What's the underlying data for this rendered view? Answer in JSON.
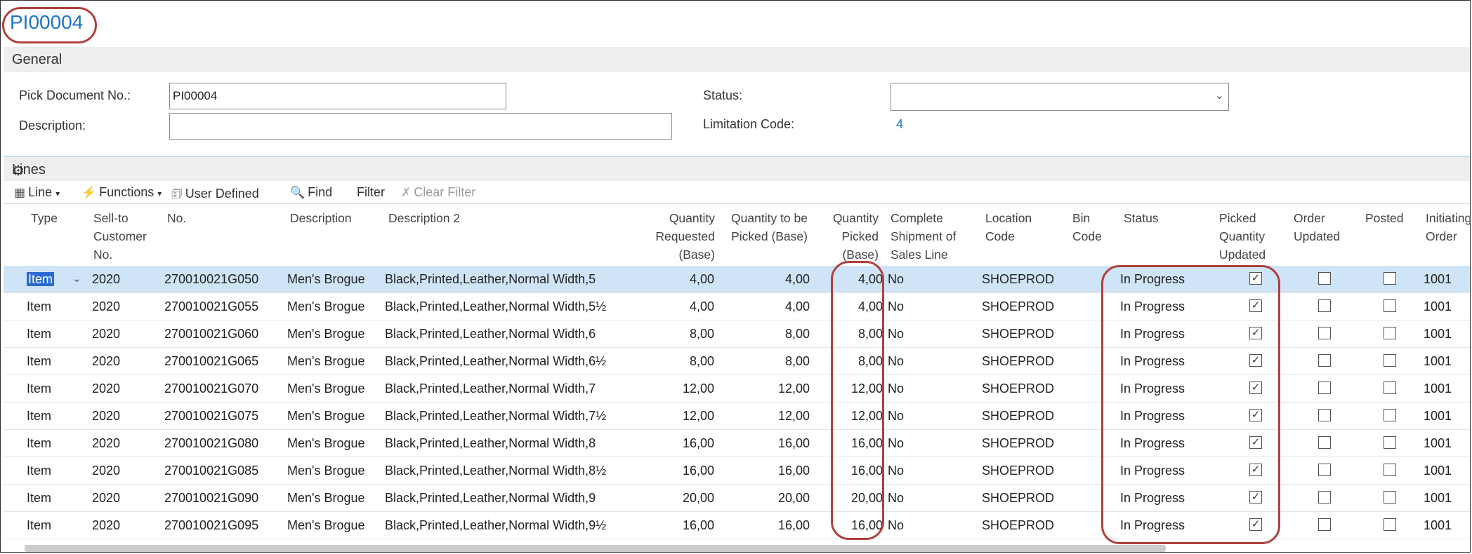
{
  "page": {
    "title": "PI00004"
  },
  "general": {
    "section_title": "General",
    "pick_document_label": "Pick Document No.:",
    "pick_document_value": "PI00004",
    "description_label": "Description:",
    "description_value": "",
    "status_label": "Status:",
    "status_value": "",
    "limitation_label": "Limitation Code:",
    "limitation_value": "4"
  },
  "lines": {
    "section_title": "Lines",
    "toolbar": {
      "line": "Line",
      "functions": "Functions",
      "user_defined": "User Defined",
      "find": "Find",
      "filter": "Filter",
      "clear_filter": "Clear Filter"
    },
    "headers": {
      "type": "Type",
      "sell_to": "Sell-to Customer No.",
      "no": "No.",
      "description": "Description",
      "description2": "Description 2",
      "qty_requested": "Quantity Requested (Base)",
      "qty_to_pick": "Quantity to be Picked (Base)",
      "qty_picked": "Quantity Picked (Base)",
      "complete_shipment": "Complete Shipment of Sales Line",
      "location": "Location Code",
      "bin": "Bin Code",
      "status": "Status",
      "picked_qty_updated": "Picked Quantity Updated",
      "order_updated": "Order Updated",
      "posted": "Posted",
      "initiating_order": "Initiating Order No."
    },
    "rows": [
      {
        "type": "Item",
        "sell_to": "2020",
        "no": "270010021G050",
        "description": "Men's Brogue",
        "description2": "Black,Printed,Leather,Normal Width,5",
        "qty_requested": "4,00",
        "qty_to_pick": "4,00",
        "qty_picked": "4,00",
        "complete_shipment": "No",
        "location": "SHOEPROD",
        "bin": "",
        "status": "In Progress",
        "picked_qty_updated": true,
        "order_updated": false,
        "posted": false,
        "initiating_order": "1001"
      },
      {
        "type": "Item",
        "sell_to": "2020",
        "no": "270010021G055",
        "description": "Men's Brogue",
        "description2": "Black,Printed,Leather,Normal Width,5½",
        "qty_requested": "4,00",
        "qty_to_pick": "4,00",
        "qty_picked": "4,00",
        "complete_shipment": "No",
        "location": "SHOEPROD",
        "bin": "",
        "status": "In Progress",
        "picked_qty_updated": true,
        "order_updated": false,
        "posted": false,
        "initiating_order": "1001"
      },
      {
        "type": "Item",
        "sell_to": "2020",
        "no": "270010021G060",
        "description": "Men's Brogue",
        "description2": "Black,Printed,Leather,Normal Width,6",
        "qty_requested": "8,00",
        "qty_to_pick": "8,00",
        "qty_picked": "8,00",
        "complete_shipment": "No",
        "location": "SHOEPROD",
        "bin": "",
        "status": "In Progress",
        "picked_qty_updated": true,
        "order_updated": false,
        "posted": false,
        "initiating_order": "1001"
      },
      {
        "type": "Item",
        "sell_to": "2020",
        "no": "270010021G065",
        "description": "Men's Brogue",
        "description2": "Black,Printed,Leather,Normal Width,6½",
        "qty_requested": "8,00",
        "qty_to_pick": "8,00",
        "qty_picked": "8,00",
        "complete_shipment": "No",
        "location": "SHOEPROD",
        "bin": "",
        "status": "In Progress",
        "picked_qty_updated": true,
        "order_updated": false,
        "posted": false,
        "initiating_order": "1001"
      },
      {
        "type": "Item",
        "sell_to": "2020",
        "no": "270010021G070",
        "description": "Men's Brogue",
        "description2": "Black,Printed,Leather,Normal Width,7",
        "qty_requested": "12,00",
        "qty_to_pick": "12,00",
        "qty_picked": "12,00",
        "complete_shipment": "No",
        "location": "SHOEPROD",
        "bin": "",
        "status": "In Progress",
        "picked_qty_updated": true,
        "order_updated": false,
        "posted": false,
        "initiating_order": "1001"
      },
      {
        "type": "Item",
        "sell_to": "2020",
        "no": "270010021G075",
        "description": "Men's Brogue",
        "description2": "Black,Printed,Leather,Normal Width,7½",
        "qty_requested": "12,00",
        "qty_to_pick": "12,00",
        "qty_picked": "12,00",
        "complete_shipment": "No",
        "location": "SHOEPROD",
        "bin": "",
        "status": "In Progress",
        "picked_qty_updated": true,
        "order_updated": false,
        "posted": false,
        "initiating_order": "1001"
      },
      {
        "type": "Item",
        "sell_to": "2020",
        "no": "270010021G080",
        "description": "Men's Brogue",
        "description2": "Black,Printed,Leather,Normal Width,8",
        "qty_requested": "16,00",
        "qty_to_pick": "16,00",
        "qty_picked": "16,00",
        "complete_shipment": "No",
        "location": "SHOEPROD",
        "bin": "",
        "status": "In Progress",
        "picked_qty_updated": true,
        "order_updated": false,
        "posted": false,
        "initiating_order": "1001"
      },
      {
        "type": "Item",
        "sell_to": "2020",
        "no": "270010021G085",
        "description": "Men's Brogue",
        "description2": "Black,Printed,Leather,Normal Width,8½",
        "qty_requested": "16,00",
        "qty_to_pick": "16,00",
        "qty_picked": "16,00",
        "complete_shipment": "No",
        "location": "SHOEPROD",
        "bin": "",
        "status": "In Progress",
        "picked_qty_updated": true,
        "order_updated": false,
        "posted": false,
        "initiating_order": "1001"
      },
      {
        "type": "Item",
        "sell_to": "2020",
        "no": "270010021G090",
        "description": "Men's Brogue",
        "description2": "Black,Printed,Leather,Normal Width,9",
        "qty_requested": "20,00",
        "qty_to_pick": "20,00",
        "qty_picked": "20,00",
        "complete_shipment": "No",
        "location": "SHOEPROD",
        "bin": "",
        "status": "In Progress",
        "picked_qty_updated": true,
        "order_updated": false,
        "posted": false,
        "initiating_order": "1001"
      },
      {
        "type": "Item",
        "sell_to": "2020",
        "no": "270010021G095",
        "description": "Men's Brogue",
        "description2": "Black,Printed,Leather,Normal Width,9½",
        "qty_requested": "16,00",
        "qty_to_pick": "16,00",
        "qty_picked": "16,00",
        "complete_shipment": "No",
        "location": "SHOEPROD",
        "bin": "",
        "status": "In Progress",
        "picked_qty_updated": true,
        "order_updated": false,
        "posted": false,
        "initiating_order": "1001"
      }
    ]
  },
  "colors": {
    "accent": "#1f74c6",
    "highlight_oval": "#b0413e",
    "selected_row": "#cfe4f7"
  },
  "icons": {
    "line": "grid-icon",
    "functions": "lightning-icon",
    "user_defined": "document-icon",
    "find": "binoculars-icon",
    "clear_filter": "clear-filter-icon",
    "settings": "gear-icon",
    "dropdown": "chevron-down-icon",
    "checkbox": "checkbox-icon"
  }
}
